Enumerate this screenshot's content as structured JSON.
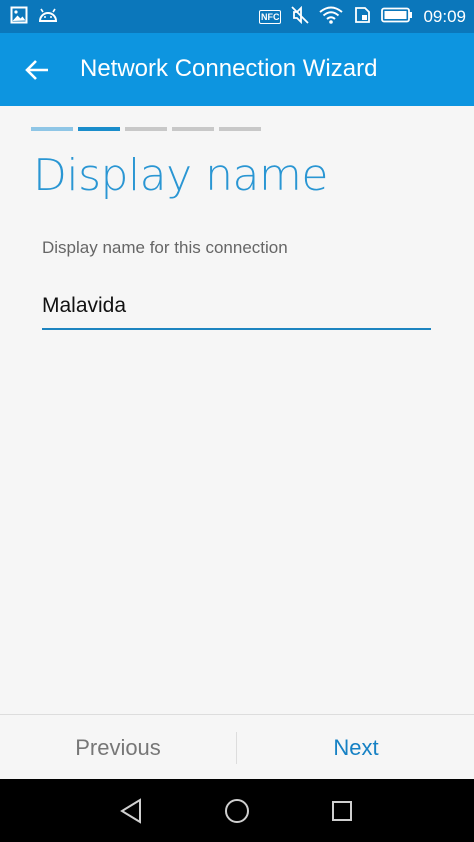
{
  "status_bar": {
    "time": "09:09",
    "nfc_label": "NFC",
    "icons": [
      "image-icon",
      "android-icon",
      "nfc-icon",
      "mute-icon",
      "wifi-icon",
      "sim-icon",
      "battery-icon"
    ],
    "background": "#0b77bb"
  },
  "app_bar": {
    "title": "Network Connection Wizard",
    "back_icon": "arrow-left-icon",
    "background": "#0d95e0"
  },
  "steps": {
    "total": 5,
    "current": 2
  },
  "content": {
    "page_title": "Display name",
    "field_label": "Display name for this connection",
    "field_value": "Malavida",
    "accent": "#2a96d3"
  },
  "footer": {
    "previous_label": "Previous",
    "next_label": "Next",
    "next_color": "#1681c4"
  },
  "nav_bar": {
    "icons": [
      "back-triangle-icon",
      "home-circle-icon",
      "recents-square-icon"
    ]
  }
}
